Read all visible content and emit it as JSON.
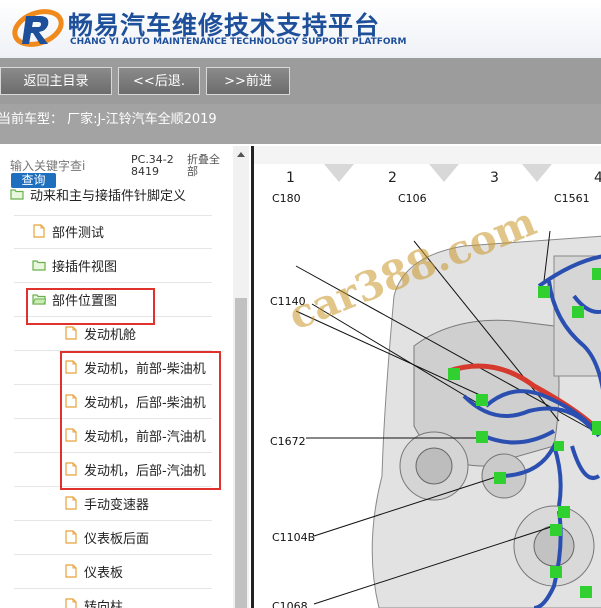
{
  "header": {
    "title": "畅易汽车维修技术支持平台",
    "subtitle": "CHANG YI AUTO MAINTENANCE TECHNOLOGY SUPPORT PLATFORM"
  },
  "toolbar": {
    "home_label": "返回主目录",
    "back_label": "<<后退.",
    "forward_label": ">>前进"
  },
  "vehicle": {
    "text": "当前车型： 厂家:J-江铃汽车全顺2019"
  },
  "search": {
    "placeholder": "输入关键字查i",
    "button": "查询",
    "pc_code": "PC.34-28419",
    "fold_all": "折叠全部"
  },
  "tree": {
    "items": [
      {
        "label": "动来和主与接插件针脚定义",
        "icon": "folder-open-icon"
      },
      {
        "label": "部件测试",
        "icon": "file-icon"
      },
      {
        "label": "接插件视图",
        "icon": "folder-icon"
      },
      {
        "label": "部件位置图",
        "icon": "folder-open-icon"
      },
      {
        "label": "发动机舱",
        "icon": "file-icon"
      },
      {
        "label": "发动机，前部-柴油机",
        "icon": "file-icon"
      },
      {
        "label": "发动机，后部-柴油机",
        "icon": "file-icon"
      },
      {
        "label": "发动机，前部-汽油机",
        "icon": "file-icon"
      },
      {
        "label": "发动机，后部-汽油机",
        "icon": "file-icon"
      },
      {
        "label": "手动变速器",
        "icon": "file-icon"
      },
      {
        "label": "仪表板后面",
        "icon": "file-icon"
      },
      {
        "label": "仪表板",
        "icon": "file-icon"
      },
      {
        "label": "转向柱",
        "icon": "file-icon"
      }
    ]
  },
  "diagram": {
    "columns": [
      "1",
      "2",
      "3",
      "4"
    ],
    "connectors": [
      "C180",
      "C106",
      "C1561",
      "C1140",
      "C1672",
      "C1104B",
      "C1068"
    ],
    "watermark": "car388.com"
  },
  "colors": {
    "brand_blue": "#1e4f9a",
    "highlight_red": "#e0322d",
    "connector_green": "#2fd02f",
    "harness_blue": "#2a4fb0"
  }
}
